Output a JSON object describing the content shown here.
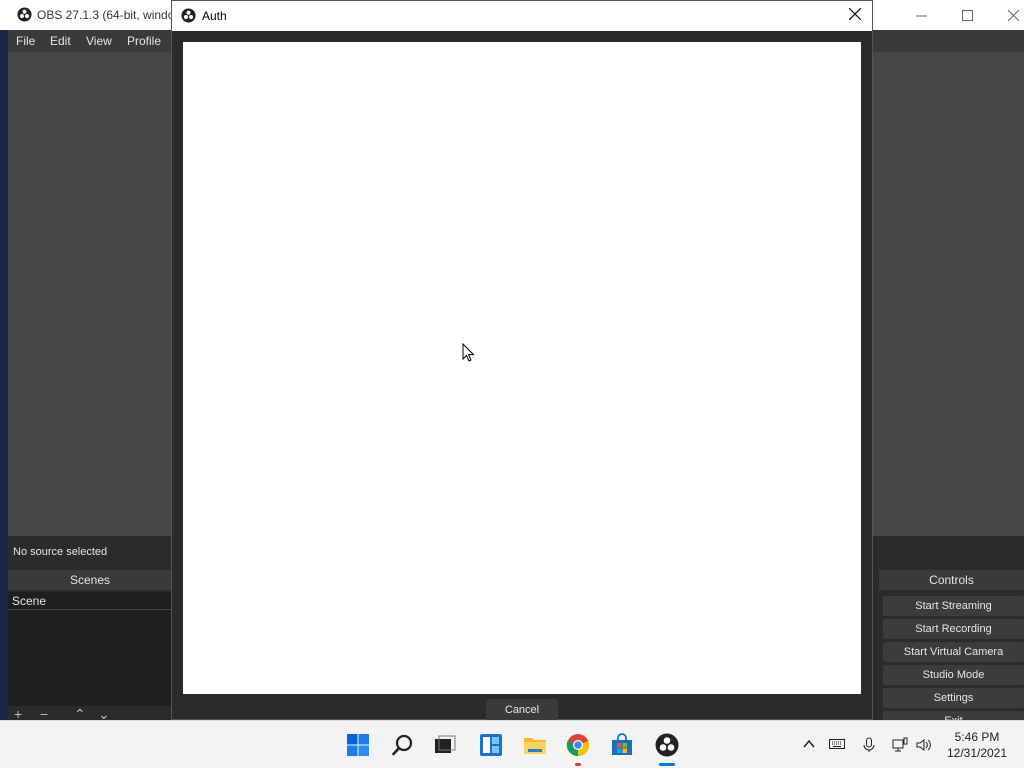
{
  "obs_window": {
    "title": "OBS 27.1.3 (64-bit, windo",
    "menu": [
      "File",
      "Edit",
      "View",
      "Profile"
    ],
    "status": "No source selected",
    "scenes": {
      "header": "Scenes",
      "items": [
        "Scene"
      ]
    },
    "controls": {
      "header": "Controls",
      "buttons": [
        "Start Streaming",
        "Start Recording",
        "Start Virtual Camera",
        "Studio Mode",
        "Settings",
        "Exit"
      ]
    }
  },
  "auth_dialog": {
    "title": "Auth",
    "cancel_label": "Cancel"
  },
  "taskbar": {
    "apps": [
      "start-icon",
      "search-icon",
      "task-view-icon",
      "widgets-icon",
      "file-explorer-icon",
      "chrome-icon",
      "store-icon",
      "obs-icon"
    ],
    "time": "5:46 PM",
    "date": "12/31/2021"
  },
  "colors": {
    "obs_bg": "#2b2b2b",
    "preview_bg": "#474747",
    "taskbar_bg": "#f3f3f3",
    "accent_blue": "#0078d4"
  }
}
